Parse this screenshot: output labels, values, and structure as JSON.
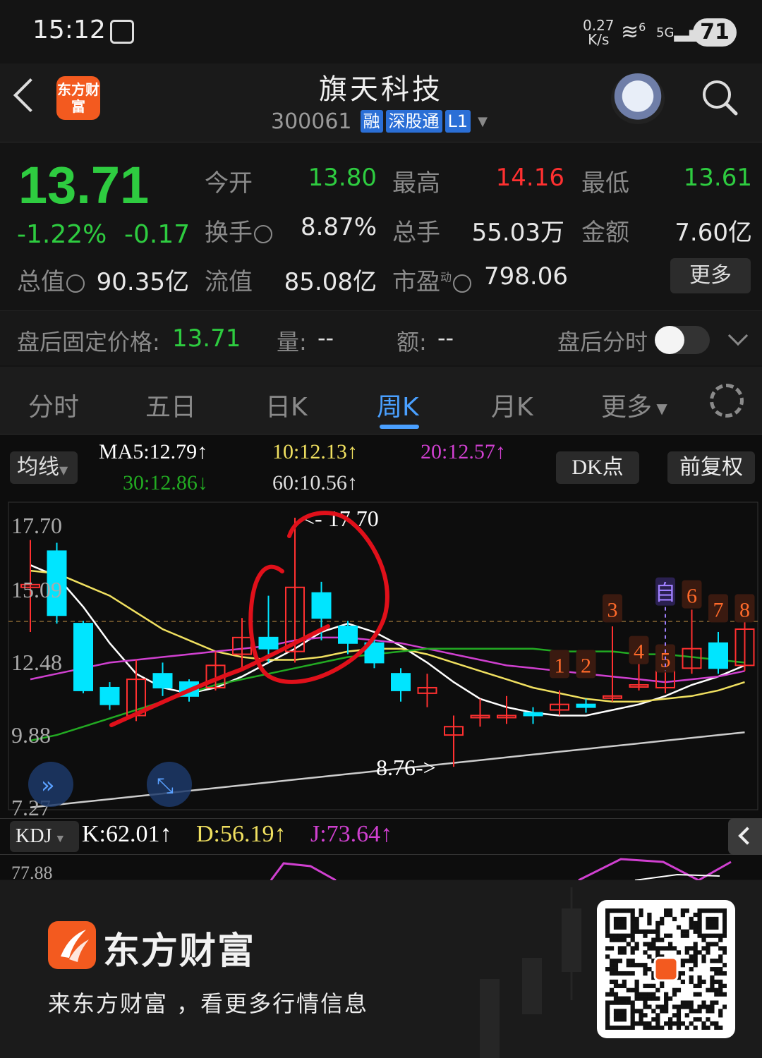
{
  "status_bar": {
    "time": "15:12",
    "net_speed_value": "0.27",
    "net_speed_unit": "K/s",
    "wifi_label": "6",
    "signal_label": "5G",
    "battery": "71"
  },
  "header": {
    "stock_name": "旗天科技",
    "stock_code": "300061",
    "tags": [
      "融",
      "深股通",
      "L1"
    ],
    "app_logo": "东方财富"
  },
  "quote": {
    "price": "13.71",
    "change_pct": "-1.22%",
    "change": "-0.17",
    "fields": [
      {
        "label": "今开",
        "value": "13.80",
        "tone": "green"
      },
      {
        "label": "最高",
        "value": "14.16",
        "tone": "red"
      },
      {
        "label": "最低",
        "value": "13.61",
        "tone": "green"
      },
      {
        "label": "换手",
        "value": "8.87%",
        "tone": "normal"
      },
      {
        "label": "总手",
        "value": "55.03万",
        "tone": "normal"
      },
      {
        "label": "金额",
        "value": "7.60亿",
        "tone": "normal"
      },
      {
        "label": "总值",
        "value": "90.35亿",
        "tone": "normal"
      },
      {
        "label": "流值",
        "value": "85.08亿",
        "tone": "normal"
      },
      {
        "label": "市盈",
        "value": "798.06",
        "tone": "normal"
      }
    ],
    "pe_superscript": "动",
    "more_label": "更多",
    "after_hours": {
      "label": "盘后固定价格:",
      "price": "13.71",
      "vol_label": "量:",
      "vol": "--",
      "amt_label": "额:",
      "amt": "--",
      "toggle_label": "盘后分时"
    }
  },
  "tabs": [
    "分时",
    "五日",
    "日K",
    "周K",
    "月K",
    "更多"
  ],
  "chart_controls": {
    "ma_button": "均线",
    "ma5": "MA5:12.79↑",
    "ma10": "10:12.13↑",
    "ma20": "20:12.57↑",
    "ma30": "30:12.86↓",
    "ma60": "60:10.56↑",
    "dk_button": "DK点",
    "adjust_button": "前复权",
    "kdj_button": "KDJ",
    "k": "K:62.01↑",
    "d": "D:56.19↑",
    "j": "J:73.64↑",
    "kdj_axis": "77.88"
  },
  "colors": {
    "up": "#ff3030",
    "down": "#00e5ff",
    "ma5": "#ffffff",
    "ma10": "#f0e060",
    "ma20": "#d040d0",
    "ma30": "#22aa22",
    "ma60": "#cccccc",
    "accent": "#4aa0ff"
  },
  "chart_data": {
    "type": "candlestick",
    "y_ticks": [
      "17.70",
      "15.09",
      "12.48",
      "9.88",
      "7.27"
    ],
    "ylim": [
      7.27,
      17.7
    ],
    "high_annotation": "<- 17.70",
    "low_annotation": "8.76->",
    "dk_markers": [
      "1",
      "2",
      "3",
      "4",
      "5",
      "自",
      "6",
      "7",
      "8"
    ],
    "candles": [
      {
        "o": 15.2,
        "c": 15.3,
        "h": 16.9,
        "l": 13.6
      },
      {
        "o": 16.5,
        "c": 14.2,
        "h": 16.8,
        "l": 13.9
      },
      {
        "o": 13.9,
        "c": 11.5,
        "h": 14.0,
        "l": 11.4
      },
      {
        "o": 11.6,
        "c": 11.0,
        "h": 11.8,
        "l": 10.8
      },
      {
        "o": 10.6,
        "c": 11.9,
        "h": 12.6,
        "l": 10.4
      },
      {
        "o": 12.1,
        "c": 11.6,
        "h": 12.5,
        "l": 11.3
      },
      {
        "o": 11.8,
        "c": 11.3,
        "h": 11.9,
        "l": 11.1
      },
      {
        "o": 11.6,
        "c": 12.4,
        "h": 12.9,
        "l": 11.5
      },
      {
        "o": 12.8,
        "c": 13.4,
        "h": 14.1,
        "l": 12.3
      },
      {
        "o": 13.4,
        "c": 13.0,
        "h": 14.9,
        "l": 12.5
      },
      {
        "o": 12.9,
        "c": 15.2,
        "h": 17.7,
        "l": 12.5
      },
      {
        "o": 15.0,
        "c": 14.1,
        "h": 15.4,
        "l": 13.3
      },
      {
        "o": 13.8,
        "c": 13.2,
        "h": 14.0,
        "l": 12.8
      },
      {
        "o": 13.2,
        "c": 12.5,
        "h": 13.4,
        "l": 12.3
      },
      {
        "o": 12.1,
        "c": 11.5,
        "h": 12.3,
        "l": 11.1
      },
      {
        "o": 11.4,
        "c": 11.6,
        "h": 12.1,
        "l": 10.9
      },
      {
        "o": 9.9,
        "c": 10.2,
        "h": 10.6,
        "l": 8.76
      },
      {
        "o": 10.6,
        "c": 10.6,
        "h": 11.2,
        "l": 10.2
      },
      {
        "o": 10.6,
        "c": 10.6,
        "h": 11.3,
        "l": 10.3
      },
      {
        "o": 10.7,
        "c": 10.6,
        "h": 10.9,
        "l": 10.3
      },
      {
        "o": 10.8,
        "c": 11.0,
        "h": 11.5,
        "l": 10.6
      },
      {
        "o": 11.0,
        "c": 10.9,
        "h": 11.2,
        "l": 10.7
      },
      {
        "o": 11.3,
        "c": 11.3,
        "h": 13.8,
        "l": 11.1
      },
      {
        "o": 11.7,
        "c": 11.7,
        "h": 12.8,
        "l": 11.5
      },
      {
        "o": 11.6,
        "c": 12.2,
        "h": 13.0,
        "l": 11.4
      },
      {
        "o": 12.3,
        "c": 13.0,
        "h": 14.4,
        "l": 12.1
      },
      {
        "o": 13.2,
        "c": 12.3,
        "h": 13.6,
        "l": 12.1
      },
      {
        "o": 12.4,
        "c": 13.7,
        "h": 14.2,
        "l": 12.2
      }
    ],
    "series": [
      {
        "name": "MA5",
        "values": [
          16.0,
          15.6,
          14.5,
          13.2,
          12.1,
          11.6,
          11.4,
          11.6,
          12.0,
          12.5,
          13.0,
          13.6,
          13.9,
          13.6,
          13.1,
          12.5,
          11.8,
          11.2,
          10.9,
          10.7,
          10.6,
          10.6,
          10.8,
          11.0,
          11.3,
          11.7,
          12.0,
          12.4
        ]
      },
      {
        "name": "10",
        "values": [
          15.8,
          15.7,
          15.3,
          14.9,
          14.3,
          13.7,
          13.3,
          12.9,
          12.7,
          12.6,
          12.6,
          12.7,
          12.9,
          13.0,
          13.0,
          12.8,
          12.5,
          12.2,
          11.9,
          11.6,
          11.4,
          11.2,
          11.1,
          11.1,
          11.2,
          11.3,
          11.5,
          11.8
        ]
      },
      {
        "name": "20",
        "values": [
          11.9,
          12.1,
          12.3,
          12.5,
          12.6,
          12.7,
          12.8,
          12.9,
          13.0,
          13.1,
          13.3,
          13.4,
          13.4,
          13.3,
          13.2,
          13.0,
          12.8,
          12.6,
          12.4,
          12.3,
          12.2,
          12.1,
          12.0,
          11.9,
          11.8,
          11.9,
          12.0,
          12.2
        ]
      },
      {
        "name": "30",
        "values": [
          9.7,
          9.9,
          10.2,
          10.5,
          10.8,
          11.1,
          11.4,
          11.7,
          11.9,
          12.1,
          12.3,
          12.5,
          12.7,
          12.8,
          12.9,
          13.0,
          13.0,
          13.0,
          13.0,
          13.0,
          12.9,
          12.9,
          12.9,
          12.8,
          12.8,
          12.7,
          12.6,
          12.5
        ]
      },
      {
        "name": "60",
        "values": [
          7.3,
          7.4,
          7.5,
          7.6,
          7.7,
          7.8,
          7.9,
          8.0,
          8.1,
          8.2,
          8.3,
          8.4,
          8.5,
          8.6,
          8.7,
          8.8,
          8.9,
          9.0,
          9.1,
          9.2,
          9.3,
          9.4,
          9.5,
          9.6,
          9.7,
          9.8,
          9.9,
          10.0
        ]
      }
    ]
  },
  "footer": {
    "brand": "东方财富",
    "slogan": "来东方财富 ，看更多行情信息"
  }
}
